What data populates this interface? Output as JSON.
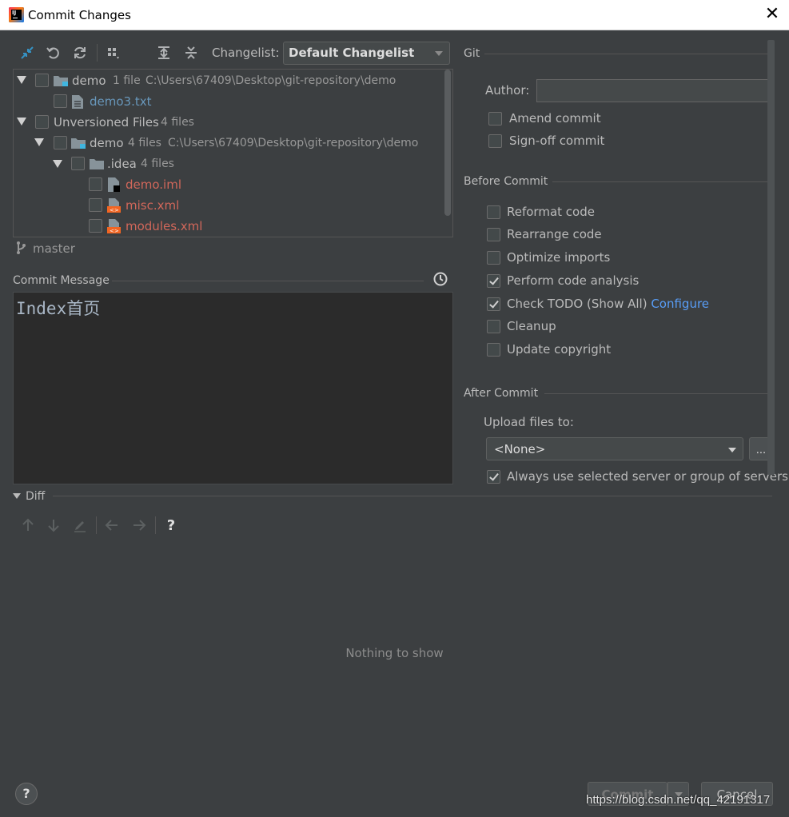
{
  "window": {
    "title": "Commit Changes"
  },
  "toolbar": {
    "changelist_label": "Changelist:",
    "changelist_value": "Default Changelist"
  },
  "tree": {
    "rows": [
      {
        "name": "demo",
        "count": "1 file",
        "path": "C:\\Users\\67409\\Desktop\\git-repository\\demo"
      },
      {
        "name": "demo3.txt"
      },
      {
        "name": "Unversioned Files",
        "count": "4 files"
      },
      {
        "name": "demo",
        "count": "4 files",
        "path": "C:\\Users\\67409\\Desktop\\git-repository\\demo"
      },
      {
        "name": ".idea",
        "count": "4 files"
      },
      {
        "name": "demo.iml"
      },
      {
        "name": "misc.xml"
      },
      {
        "name": "modules.xml"
      }
    ]
  },
  "branch": "master",
  "commit_message": {
    "label": "Commit Message",
    "text": "Index首页"
  },
  "git": {
    "section": "Git",
    "author_label": "Author:",
    "author_value": "",
    "amend": "Amend commit",
    "signoff": "Sign-off commit"
  },
  "before_commit": {
    "section": "Before Commit",
    "options": [
      {
        "label": "Reformat code",
        "checked": false
      },
      {
        "label": "Rearrange code",
        "checked": false
      },
      {
        "label": "Optimize imports",
        "checked": false
      },
      {
        "label": "Perform code analysis",
        "checked": true
      },
      {
        "label": "Check TODO (Show All)",
        "checked": true,
        "link": "Configure"
      },
      {
        "label": "Cleanup",
        "checked": false
      },
      {
        "label": "Update copyright",
        "checked": false
      }
    ]
  },
  "after_commit": {
    "section": "After Commit",
    "upload_label": "Upload files to:",
    "upload_value": "<None>",
    "browse_label": "...",
    "always_use": "Always use selected server or group of servers"
  },
  "diff": {
    "label": "Diff",
    "empty_text": "Nothing to show",
    "help": "?"
  },
  "buttons": {
    "help": "?",
    "commit": "Commit",
    "cancel": "Cancel"
  },
  "watermark": "https://blog.csdn.net/qq_42191317"
}
